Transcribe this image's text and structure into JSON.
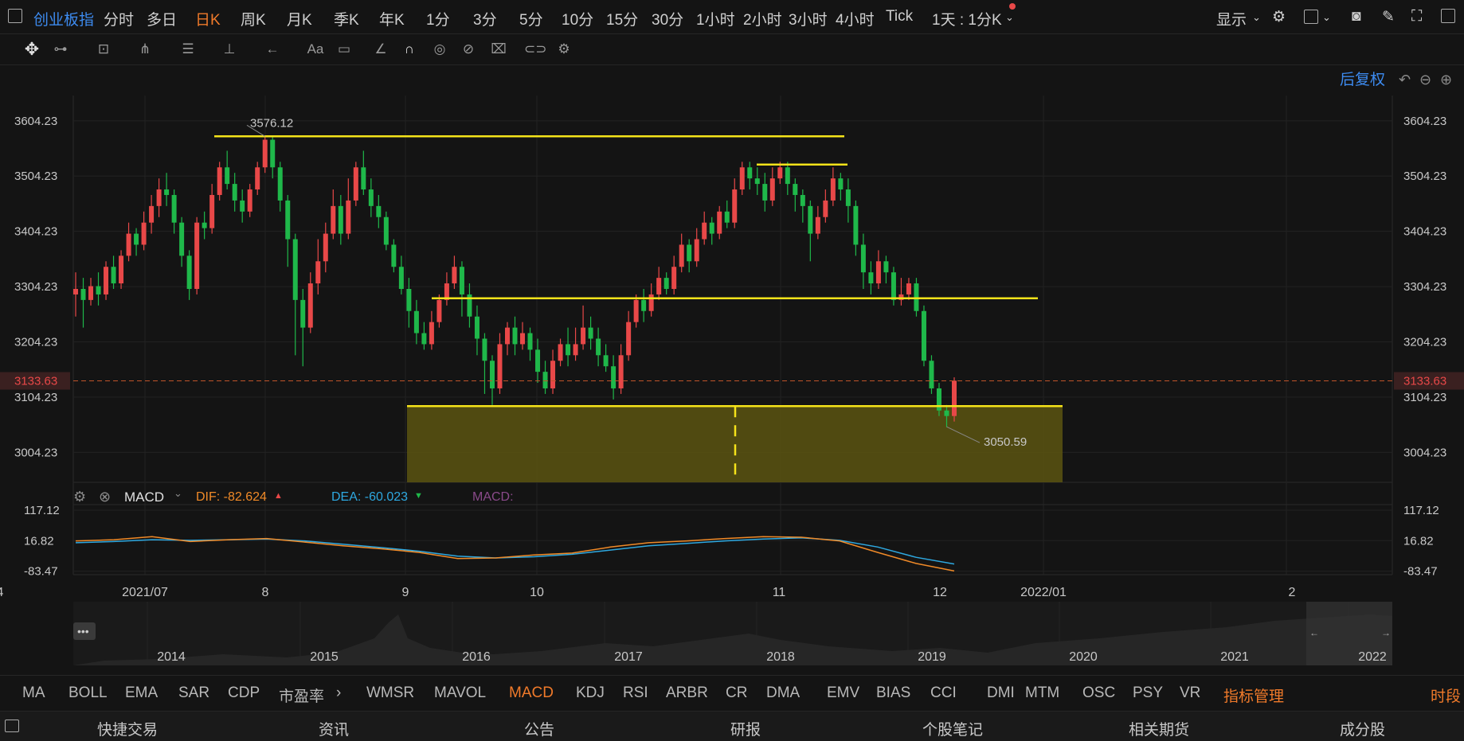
{
  "toolbar": {
    "symbol": "创业板指",
    "periods": [
      "分时",
      "多日",
      "日K",
      "周K",
      "月K",
      "季K",
      "年K",
      "1分",
      "3分",
      "5分",
      "10分",
      "15分",
      "30分",
      "1小时",
      "2小时",
      "3小时",
      "4小时",
      "Tick"
    ],
    "active_period": "日K",
    "combo": "1天 : 1分K",
    "display_label": "显示"
  },
  "chart_header": {
    "adjust_label": "后复权"
  },
  "macd_legend": {
    "name": "MACD",
    "dif_label": "DIF: -82.624",
    "dea_label": "DEA: -60.023",
    "macd_label": "MACD:"
  },
  "indicator_bar": {
    "items": [
      "MA",
      "BOLL",
      "EMA",
      "SAR",
      "CDP",
      "市盈率",
      "WMSR",
      "MAVOL",
      "MACD",
      "KDJ",
      "RSI",
      "ARBR",
      "CR",
      "DMA",
      "EMV",
      "BIAS",
      "CCI",
      "DMI",
      "MTM",
      "OSC",
      "PSY",
      "VR"
    ],
    "active": "MACD",
    "manage_label": "指标管理",
    "period_label": "时段"
  },
  "bottom_tabs": [
    "快捷交易",
    "资讯",
    "公告",
    "研报",
    "个股笔记",
    "相关期货",
    "成分股"
  ],
  "colors": {
    "up": "#e84848",
    "down": "#1fb84a",
    "accent": "#3d8bf0",
    "active": "#f07a2a",
    "drawline": "#f5e31a",
    "dif": "#f08a28",
    "dea": "#2ea8e0"
  },
  "chart_data": {
    "type": "candlestick",
    "y_ticks": [
      "3604.23",
      "3504.23",
      "3404.23",
      "3304.23",
      "3204.23",
      "3104.23",
      "3004.23"
    ],
    "y_ticks_values": [
      3604.23,
      3504.23,
      3404.23,
      3304.23,
      3204.23,
      3104.23,
      3004.23
    ],
    "ylim": [
      2950,
      3650
    ],
    "last_price": "3133.63",
    "last_price_value": 3133.63,
    "high_label": "3576.12",
    "low_label": "3050.59",
    "x_labels": [
      "2021/07",
      "8",
      "9",
      "10",
      "11",
      "12",
      "2022/01",
      "2",
      "4"
    ],
    "macd_y_ticks": [
      "117.12",
      "16.82",
      "-83.47"
    ],
    "macd_y_ticks_values": [
      117.12,
      16.82,
      -83.47
    ],
    "dif": [
      16,
      20,
      30,
      14,
      20,
      24,
      12,
      0,
      -10,
      -22,
      -42,
      -40,
      -30,
      -24,
      -4,
      10,
      16,
      24,
      30,
      28,
      16,
      -22,
      -58,
      -83
    ],
    "dea": [
      10,
      14,
      20,
      18,
      20,
      22,
      16,
      5,
      -6,
      -18,
      -34,
      -40,
      -36,
      -28,
      -14,
      0,
      8,
      16,
      22,
      26,
      18,
      -4,
      -38,
      -60
    ],
    "overview_x_labels": [
      "2014",
      "2015",
      "2016",
      "2017",
      "2018",
      "2019",
      "2020",
      "2021",
      "2022"
    ],
    "candles": [
      [
        3290,
        3300,
        3250,
        3330
      ],
      [
        3300,
        3280,
        3230,
        3320
      ],
      [
        3280,
        3305,
        3270,
        3320
      ],
      [
        3305,
        3290,
        3270,
        3330
      ],
      [
        3290,
        3340,
        3280,
        3350
      ],
      [
        3340,
        3310,
        3300,
        3360
      ],
      [
        3310,
        3360,
        3300,
        3370
      ],
      [
        3360,
        3400,
        3350,
        3420
      ],
      [
        3400,
        3380,
        3360,
        3410
      ],
      [
        3380,
        3420,
        3370,
        3440
      ],
      [
        3420,
        3450,
        3400,
        3470
      ],
      [
        3450,
        3480,
        3430,
        3500
      ],
      [
        3480,
        3470,
        3450,
        3510
      ],
      [
        3470,
        3420,
        3400,
        3480
      ],
      [
        3420,
        3360,
        3340,
        3430
      ],
      [
        3360,
        3300,
        3280,
        3370
      ],
      [
        3300,
        3420,
        3290,
        3430
      ],
      [
        3420,
        3410,
        3390,
        3440
      ],
      [
        3410,
        3470,
        3400,
        3490
      ],
      [
        3470,
        3520,
        3460,
        3530
      ],
      [
        3520,
        3490,
        3480,
        3550
      ],
      [
        3490,
        3460,
        3440,
        3510
      ],
      [
        3460,
        3440,
        3420,
        3480
      ],
      [
        3440,
        3480,
        3430,
        3490
      ],
      [
        3480,
        3520,
        3470,
        3530
      ],
      [
        3520,
        3570,
        3510,
        3576
      ],
      [
        3570,
        3520,
        3500,
        3576
      ],
      [
        3520,
        3460,
        3440,
        3530
      ],
      [
        3460,
        3390,
        3340,
        3470
      ],
      [
        3390,
        3280,
        3180,
        3400
      ],
      [
        3280,
        3230,
        3160,
        3300
      ],
      [
        3230,
        3310,
        3220,
        3330
      ],
      [
        3310,
        3350,
        3290,
        3390
      ],
      [
        3350,
        3400,
        3330,
        3420
      ],
      [
        3400,
        3450,
        3390,
        3480
      ],
      [
        3450,
        3400,
        3380,
        3470
      ],
      [
        3400,
        3460,
        3390,
        3500
      ],
      [
        3460,
        3520,
        3450,
        3530
      ],
      [
        3520,
        3480,
        3470,
        3550
      ],
      [
        3480,
        3450,
        3430,
        3500
      ],
      [
        3450,
        3430,
        3410,
        3470
      ],
      [
        3430,
        3380,
        3370,
        3440
      ],
      [
        3380,
        3340,
        3330,
        3390
      ],
      [
        3340,
        3300,
        3290,
        3360
      ],
      [
        3300,
        3260,
        3230,
        3320
      ],
      [
        3260,
        3220,
        3200,
        3280
      ],
      [
        3220,
        3200,
        3190,
        3240
      ],
      [
        3200,
        3240,
        3190,
        3260
      ],
      [
        3240,
        3280,
        3230,
        3290
      ],
      [
        3280,
        3310,
        3270,
        3330
      ],
      [
        3310,
        3340,
        3300,
        3360
      ],
      [
        3340,
        3290,
        3250,
        3350
      ],
      [
        3290,
        3250,
        3230,
        3310
      ],
      [
        3250,
        3210,
        3180,
        3270
      ],
      [
        3210,
        3170,
        3110,
        3220
      ],
      [
        3170,
        3120,
        3090,
        3180
      ],
      [
        3120,
        3200,
        3110,
        3220
      ],
      [
        3200,
        3230,
        3180,
        3240
      ],
      [
        3230,
        3200,
        3180,
        3250
      ],
      [
        3200,
        3220,
        3190,
        3240
      ],
      [
        3220,
        3190,
        3170,
        3230
      ],
      [
        3190,
        3150,
        3130,
        3210
      ],
      [
        3150,
        3120,
        3110,
        3170
      ],
      [
        3120,
        3170,
        3110,
        3190
      ],
      [
        3170,
        3200,
        3160,
        3210
      ],
      [
        3200,
        3180,
        3160,
        3230
      ],
      [
        3180,
        3200,
        3170,
        3230
      ],
      [
        3200,
        3230,
        3190,
        3270
      ],
      [
        3230,
        3210,
        3190,
        3250
      ],
      [
        3210,
        3180,
        3160,
        3230
      ],
      [
        3180,
        3160,
        3150,
        3200
      ],
      [
        3160,
        3120,
        3100,
        3180
      ],
      [
        3120,
        3180,
        3110,
        3200
      ],
      [
        3180,
        3240,
        3170,
        3260
      ],
      [
        3240,
        3280,
        3230,
        3290
      ],
      [
        3280,
        3260,
        3240,
        3300
      ],
      [
        3260,
        3290,
        3250,
        3310
      ],
      [
        3290,
        3320,
        3280,
        3340
      ],
      [
        3320,
        3300,
        3290,
        3330
      ],
      [
        3300,
        3340,
        3290,
        3360
      ],
      [
        3340,
        3380,
        3330,
        3400
      ],
      [
        3380,
        3350,
        3330,
        3390
      ],
      [
        3350,
        3390,
        3340,
        3410
      ],
      [
        3390,
        3420,
        3380,
        3440
      ],
      [
        3420,
        3400,
        3380,
        3430
      ],
      [
        3400,
        3440,
        3390,
        3450
      ],
      [
        3440,
        3420,
        3410,
        3460
      ],
      [
        3420,
        3480,
        3410,
        3500
      ],
      [
        3480,
        3520,
        3470,
        3530
      ],
      [
        3520,
        3500,
        3480,
        3530
      ],
      [
        3500,
        3490,
        3470,
        3520
      ],
      [
        3490,
        3460,
        3440,
        3510
      ],
      [
        3460,
        3500,
        3450,
        3520
      ],
      [
        3500,
        3520,
        3490,
        3530
      ],
      [
        3520,
        3490,
        3470,
        3530
      ],
      [
        3490,
        3470,
        3440,
        3500
      ],
      [
        3470,
        3450,
        3420,
        3480
      ],
      [
        3450,
        3400,
        3350,
        3460
      ],
      [
        3400,
        3430,
        3390,
        3450
      ],
      [
        3430,
        3460,
        3420,
        3480
      ],
      [
        3460,
        3500,
        3450,
        3520
      ],
      [
        3500,
        3480,
        3460,
        3510
      ],
      [
        3480,
        3450,
        3420,
        3500
      ],
      [
        3450,
        3380,
        3360,
        3460
      ],
      [
        3380,
        3330,
        3300,
        3400
      ],
      [
        3330,
        3310,
        3290,
        3350
      ],
      [
        3310,
        3350,
        3300,
        3370
      ],
      [
        3350,
        3330,
        3310,
        3360
      ],
      [
        3330,
        3280,
        3270,
        3340
      ],
      [
        3280,
        3290,
        3270,
        3320
      ],
      [
        3290,
        3310,
        3280,
        3320
      ],
      [
        3310,
        3260,
        3250,
        3320
      ],
      [
        3260,
        3170,
        3160,
        3270
      ],
      [
        3170,
        3120,
        3110,
        3180
      ],
      [
        3120,
        3080,
        3070,
        3130
      ],
      [
        3080,
        3070,
        3050,
        3090
      ],
      [
        3070,
        3134,
        3060,
        3140
      ]
    ],
    "levels": [
      3576.12,
      3525,
      3283,
      3088
    ]
  }
}
